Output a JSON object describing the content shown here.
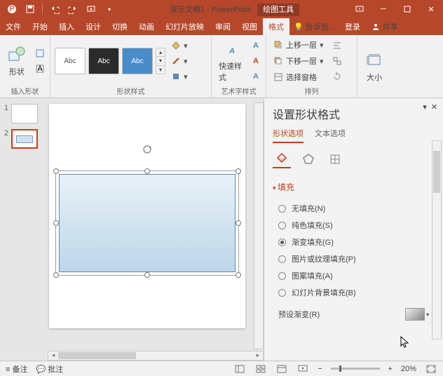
{
  "titlebar": {
    "doc": "演示文稿1 - PowerPoint",
    "context": "绘图工具"
  },
  "tabs": [
    "文件",
    "开始",
    "插入",
    "设计",
    "切换",
    "动画",
    "幻灯片放映",
    "审阅",
    "视图",
    "格式"
  ],
  "tell": "告诉我...",
  "login": "登录",
  "share": "共享",
  "ribbon": {
    "insert_shapes": {
      "btn": "形状",
      "label": "插入形状"
    },
    "styles": {
      "abc": "Abc",
      "label": "形状样式"
    },
    "wordart": {
      "btn": "快速样式",
      "label": "艺术字样式"
    },
    "arrange": {
      "up": "上移一层",
      "down": "下移一层",
      "sel": "选择窗格",
      "label": "排列"
    },
    "size": {
      "btn": "大小"
    }
  },
  "thumbs": [
    {
      "n": "1"
    },
    {
      "n": "2"
    }
  ],
  "pane": {
    "title": "设置形状格式",
    "tabs": {
      "shape": "形状选项",
      "text": "文本选项"
    },
    "section": "填充",
    "opts": {
      "none": "无填充(N)",
      "solid": "纯色填充(S)",
      "grad": "渐变填充(G)",
      "pic": "图片或纹理填充(P)",
      "pat": "图案填充(A)",
      "bg": "幻灯片背景填充(B)"
    },
    "preset": "预设渐变(R)"
  },
  "status": {
    "notes": "备注",
    "comments": "批注",
    "zoom": "20%"
  }
}
